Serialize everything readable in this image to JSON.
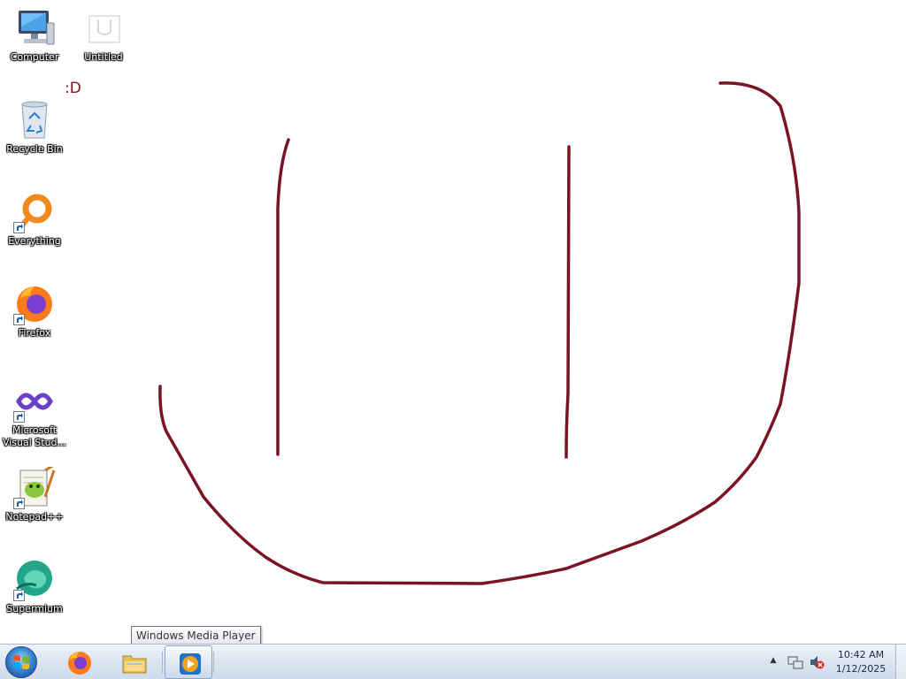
{
  "desktop": {
    "icons": [
      {
        "label": "Computer",
        "icon": "computer-icon"
      },
      {
        "label": "Untitled",
        "icon": "paint-document-icon"
      },
      {
        "label": "Recycle Bin",
        "icon": "recycle-bin-icon"
      },
      {
        "label": "Everything",
        "icon": "everything-search-icon"
      },
      {
        "label": "Firefox",
        "icon": "firefox-icon"
      },
      {
        "label": "Microsoft Visual Stud...",
        "icon": "visual-studio-icon"
      },
      {
        "label": "Notepad++",
        "icon": "notepad-plus-plus-icon"
      },
      {
        "label": "Supermium",
        "icon": "supermium-icon"
      }
    ],
    "wallpaper_text": ":D",
    "drawing_color": "#7a1424"
  },
  "tooltip": {
    "text": "Windows Media Player"
  },
  "taskbar": {
    "start_icon": "windows-logo-icon",
    "pinned": [
      {
        "name": "Firefox",
        "icon": "firefox-icon"
      },
      {
        "name": "Windows Explorer",
        "icon": "folder-icon"
      },
      {
        "name": "Windows Media Player",
        "icon": "media-player-icon",
        "active": true
      }
    ],
    "tray": {
      "icons": [
        "show-hidden-icons-arrow",
        "network-icon",
        "volume-muted-icon"
      ],
      "time": "10:42 AM",
      "date": "1/12/2025"
    }
  }
}
